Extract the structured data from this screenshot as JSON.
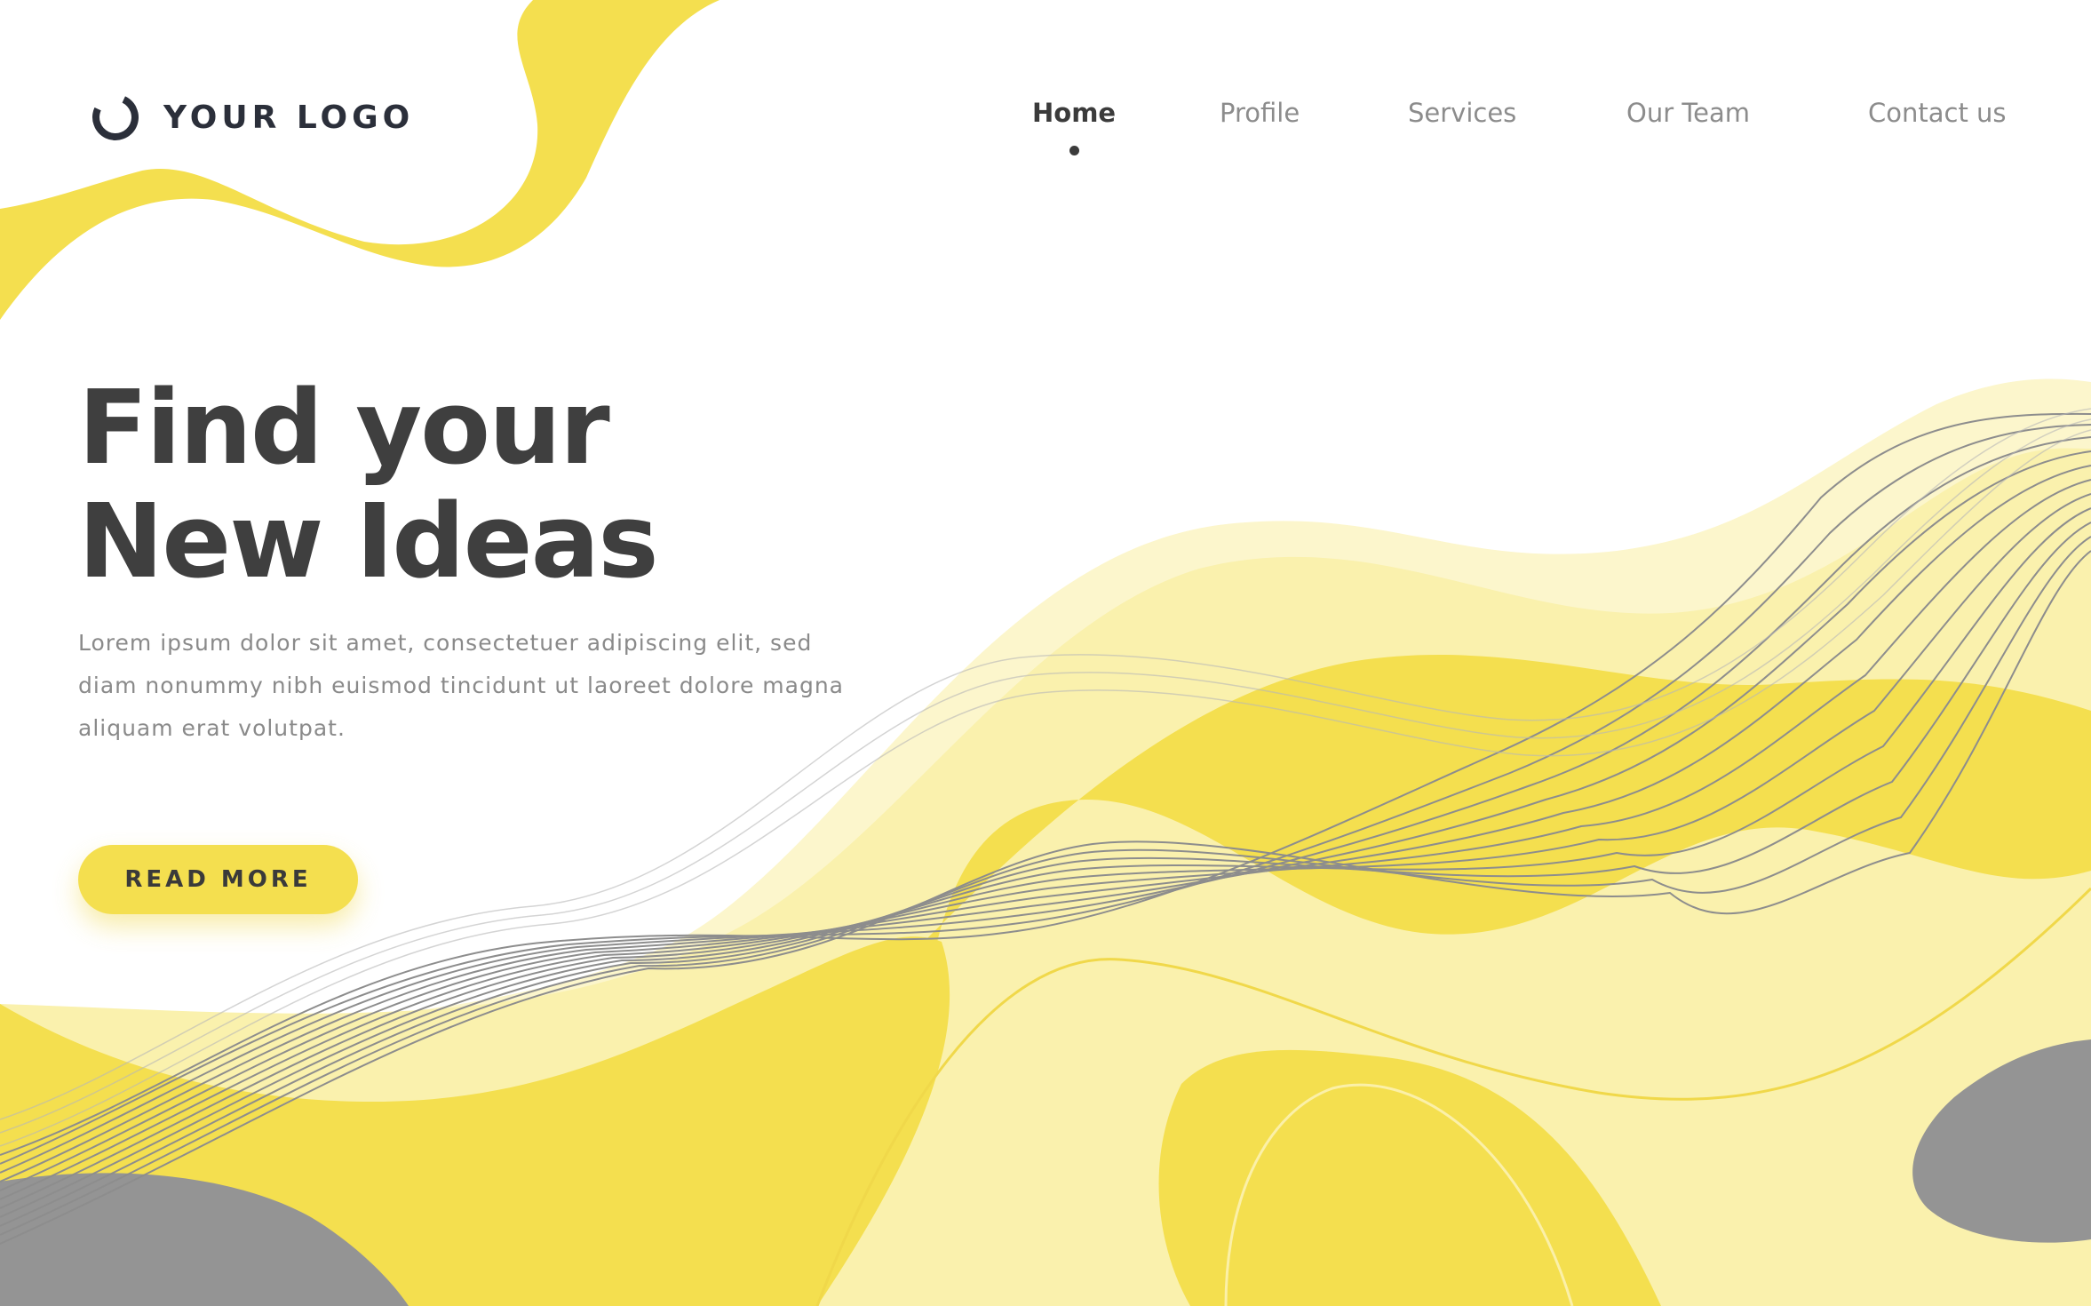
{
  "brand": {
    "logo_text": "YOUR LOGO",
    "logo_icon": "ring-icon"
  },
  "nav": {
    "items": [
      {
        "label": "Home",
        "active": true
      },
      {
        "label": "Profile",
        "active": false
      },
      {
        "label": "Services",
        "active": false
      },
      {
        "label": "Our Team",
        "active": false
      },
      {
        "label": "Contact us",
        "active": false
      }
    ]
  },
  "hero": {
    "title_line1": "Find your",
    "title_line2": "New Ideas",
    "description": "Lorem ipsum dolor sit amet, consectetuer adipiscing elit, sed diam nonummy nibh euismod tincidunt ut laoreet dolore magna aliquam erat volutpat.",
    "button_label": "READ MORE"
  },
  "colors": {
    "accent_yellow": "#f4df4f",
    "light_yellow": "#faf1ad",
    "pale_yellow": "#fcf6cc",
    "gray": "#949494",
    "text_dark": "#3f3f3f",
    "text_muted": "#8a8a8a"
  }
}
